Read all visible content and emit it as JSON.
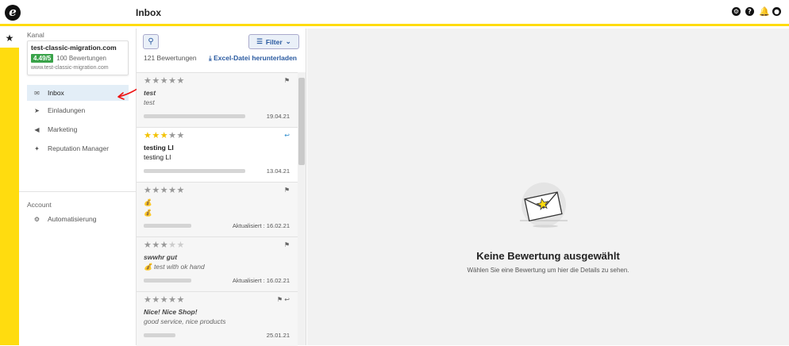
{
  "header": {
    "logo": "e",
    "title": "Inbox",
    "icons": [
      "settings-icon",
      "help-icon",
      "bell-icon",
      "user-icon"
    ]
  },
  "rail": {
    "star": "★"
  },
  "sidebar": {
    "channel_label": "Kanal",
    "channel": {
      "name": "test-classic-migration.com",
      "rating": "4.49/5",
      "reviews": "100 Bewertungen",
      "url": "www.test-classic-migration.com"
    },
    "items": [
      {
        "label": "Inbox",
        "icon": "inbox-icon",
        "active": true
      },
      {
        "label": "Einladungen",
        "icon": "paper-plane-icon"
      },
      {
        "label": "Marketing",
        "icon": "megaphone-icon"
      },
      {
        "label": "Reputation Manager",
        "icon": "sparkle-icon"
      }
    ],
    "account_label": "Account",
    "account_items": [
      {
        "label": "Automatisierung",
        "icon": "robot-icon"
      }
    ]
  },
  "list": {
    "filter_label": "Filter",
    "count": "121 Bewertungen",
    "excel_label": "Excel-Datei herunterladen",
    "reviews": [
      {
        "stars": 0,
        "title": "test",
        "body": "test",
        "date": "19.04.21",
        "flag": true,
        "reply": false,
        "italic": true,
        "grey": true
      },
      {
        "stars": 3,
        "title": "testing LI",
        "body": "testing LI",
        "date": "13.04.21",
        "flag": false,
        "reply": true,
        "italic": false,
        "grey": false
      },
      {
        "stars": 0,
        "title": "💰",
        "body": "💰",
        "date": "Aktualisiert : 16.02.21",
        "flag": true,
        "reply": false,
        "italic": false,
        "grey": true
      },
      {
        "stars": 0,
        "title": "swwhr gut",
        "body": "💰 test with ok hand",
        "date": "Aktualisiert : 16.02.21",
        "flag": true,
        "reply": false,
        "italic": true,
        "grey": true,
        "half": true
      },
      {
        "stars": 0,
        "title": "Nice! Nice Shop!",
        "body": "good service, nice products",
        "date": "25.01.21",
        "flag": true,
        "reply": true,
        "italic": true,
        "grey": true
      }
    ]
  },
  "detail": {
    "empty_title": "Keine Bewertung ausgewählt",
    "empty_sub": "Wählen Sie eine Bewertung um hier die Details zu sehen."
  }
}
